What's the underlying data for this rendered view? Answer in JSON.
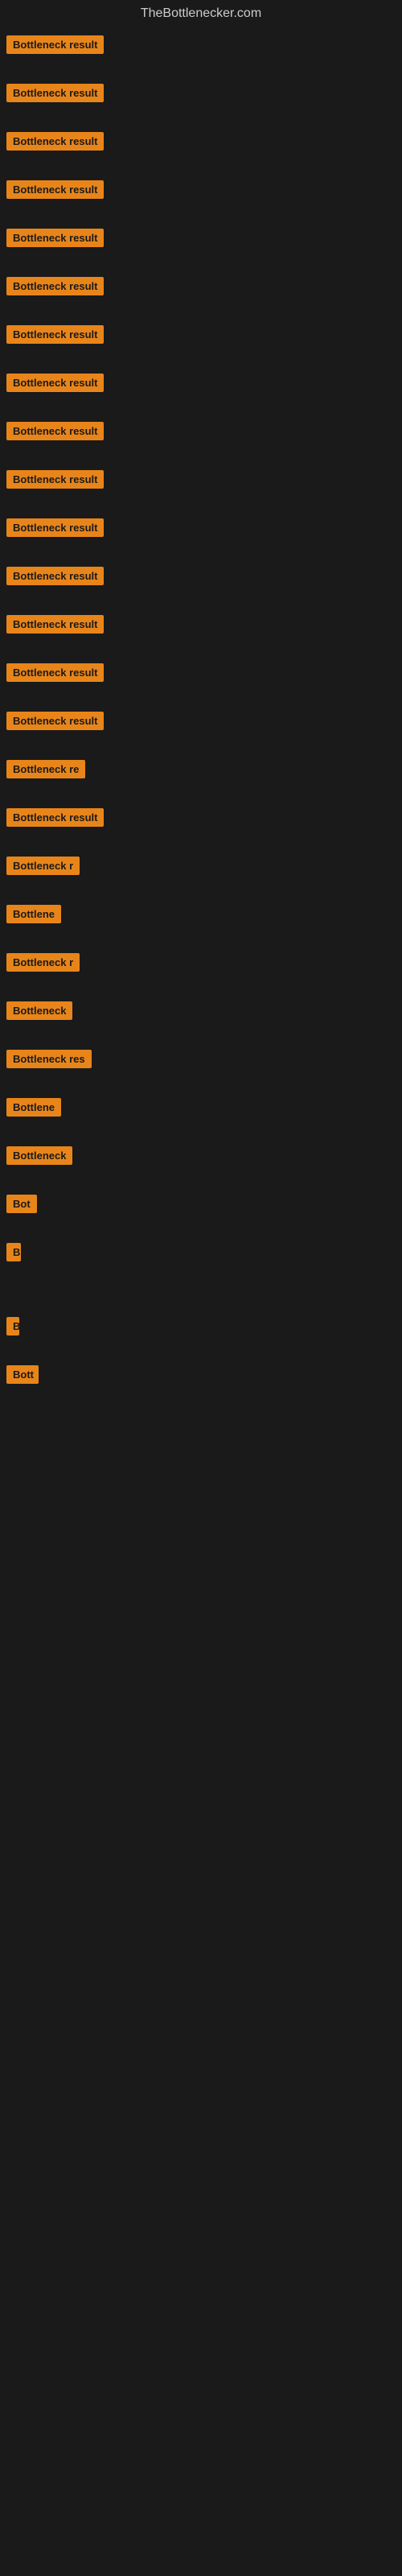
{
  "site": {
    "title": "TheBottlenecker.com"
  },
  "items": [
    {
      "id": 1,
      "label": "Bottleneck result",
      "width": 130
    },
    {
      "id": 2,
      "label": "Bottleneck result",
      "width": 130
    },
    {
      "id": 3,
      "label": "Bottleneck result",
      "width": 130
    },
    {
      "id": 4,
      "label": "Bottleneck result",
      "width": 130
    },
    {
      "id": 5,
      "label": "Bottleneck result",
      "width": 130
    },
    {
      "id": 6,
      "label": "Bottleneck result",
      "width": 130
    },
    {
      "id": 7,
      "label": "Bottleneck result",
      "width": 130
    },
    {
      "id": 8,
      "label": "Bottleneck result",
      "width": 130
    },
    {
      "id": 9,
      "label": "Bottleneck result",
      "width": 130
    },
    {
      "id": 10,
      "label": "Bottleneck result",
      "width": 130
    },
    {
      "id": 11,
      "label": "Bottleneck result",
      "width": 130
    },
    {
      "id": 12,
      "label": "Bottleneck result",
      "width": 130
    },
    {
      "id": 13,
      "label": "Bottleneck result",
      "width": 130
    },
    {
      "id": 14,
      "label": "Bottleneck result",
      "width": 130
    },
    {
      "id": 15,
      "label": "Bottleneck result",
      "width": 130
    },
    {
      "id": 16,
      "label": "Bottleneck re",
      "width": 108
    },
    {
      "id": 17,
      "label": "Bottleneck result",
      "width": 128
    },
    {
      "id": 18,
      "label": "Bottleneck r",
      "width": 100
    },
    {
      "id": 19,
      "label": "Bottlene",
      "width": 80
    },
    {
      "id": 20,
      "label": "Bottleneck r",
      "width": 98
    },
    {
      "id": 21,
      "label": "Bottleneck",
      "width": 88
    },
    {
      "id": 22,
      "label": "Bottleneck res",
      "width": 112
    },
    {
      "id": 23,
      "label": "Bottlene",
      "width": 78
    },
    {
      "id": 24,
      "label": "Bottleneck",
      "width": 84
    },
    {
      "id": 25,
      "label": "Bot",
      "width": 42
    },
    {
      "id": 26,
      "label": "B",
      "width": 18
    },
    {
      "id": 27,
      "label": "",
      "width": 0
    },
    {
      "id": 28,
      "label": "B",
      "width": 14
    },
    {
      "id": 29,
      "label": "Bott",
      "width": 40
    },
    {
      "id": 30,
      "label": "",
      "width": 0
    },
    {
      "id": 31,
      "label": "",
      "width": 0
    },
    {
      "id": 32,
      "label": "",
      "width": 0
    },
    {
      "id": 33,
      "label": "",
      "width": 0
    }
  ]
}
